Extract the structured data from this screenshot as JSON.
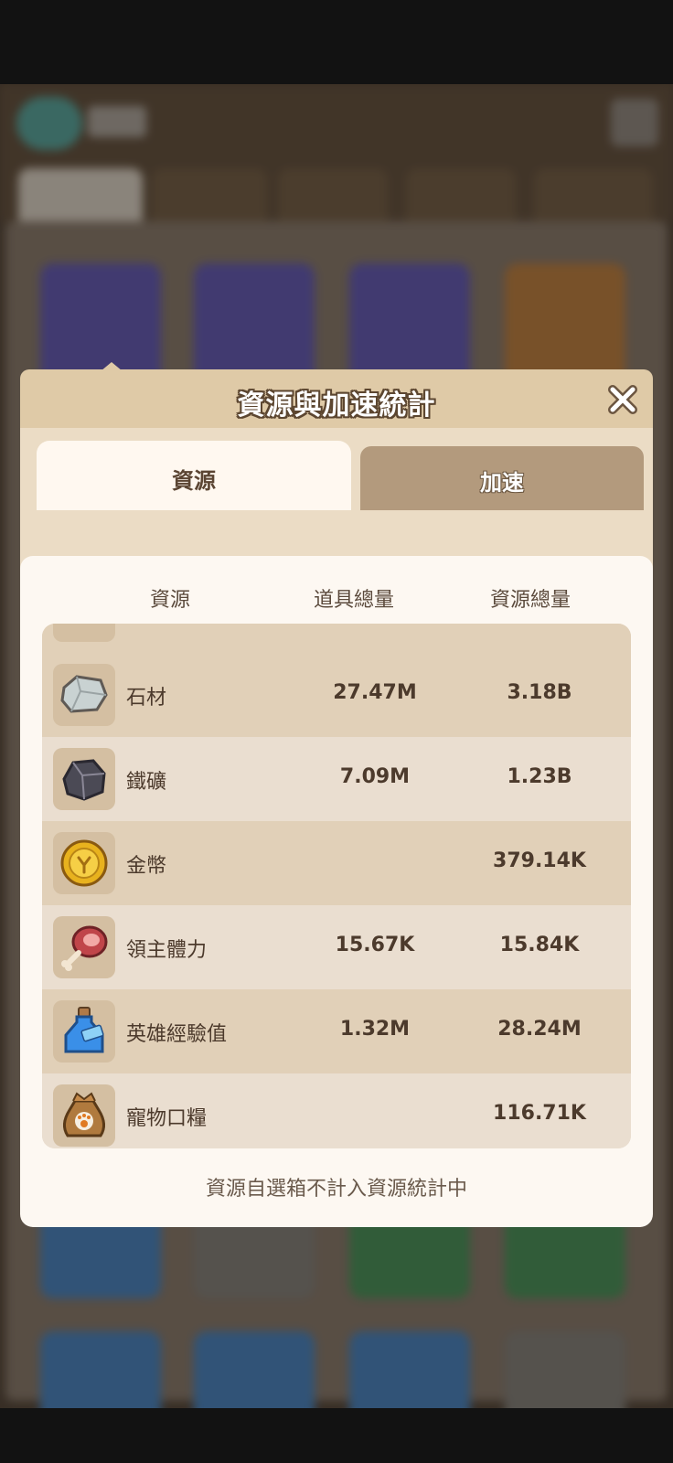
{
  "background": {
    "blurred": true
  },
  "modal": {
    "title": "資源與加速統計",
    "close_icon": "close-icon",
    "tabs": [
      {
        "label": "資源",
        "active": true
      },
      {
        "label": "加速",
        "active": false
      }
    ],
    "columns": {
      "resource": "資源",
      "item_total": "道具總量",
      "resource_total": "資源總量"
    },
    "rows": [
      {
        "icon": "wood-icon",
        "name": "",
        "item_total": "",
        "resource_total": ""
      },
      {
        "icon": "stone-icon",
        "name": "石材",
        "item_total": "27.47M",
        "resource_total": "3.18B"
      },
      {
        "icon": "iron-ore-icon",
        "name": "鐵礦",
        "item_total": "7.09M",
        "resource_total": "1.23B"
      },
      {
        "icon": "gold-coin-icon",
        "name": "金幣",
        "item_total": "",
        "resource_total": "379.14K"
      },
      {
        "icon": "meat-icon",
        "name": "領主體力",
        "item_total": "15.67K",
        "resource_total": "15.84K"
      },
      {
        "icon": "exp-potion-icon",
        "name": "英雄經驗值",
        "item_total": "1.32M",
        "resource_total": "28.24M"
      },
      {
        "icon": "pet-food-bag-icon",
        "name": "寵物口糧",
        "item_total": "",
        "resource_total": "116.71K"
      }
    ],
    "footnote": "資源自選箱不計入資源統計中"
  }
}
